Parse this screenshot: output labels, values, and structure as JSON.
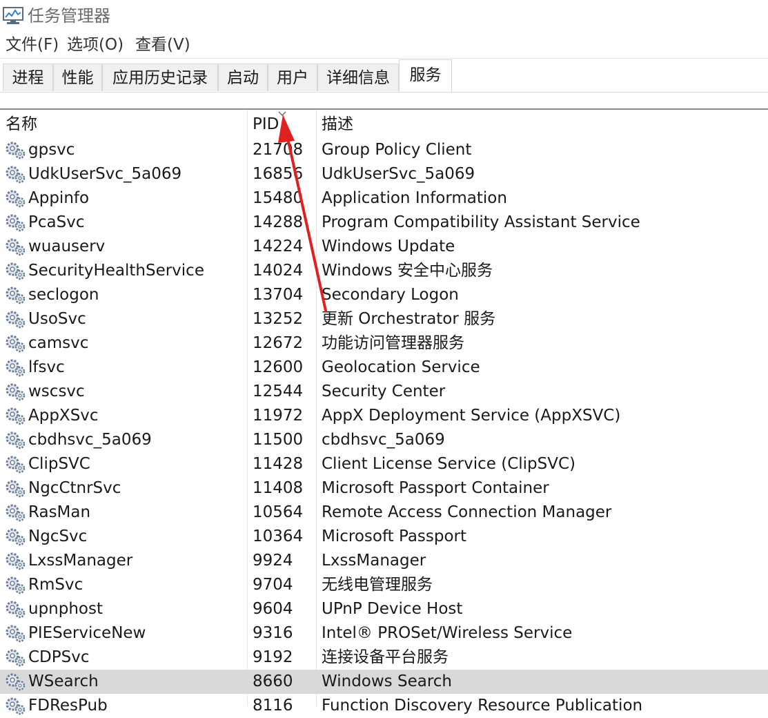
{
  "window": {
    "title": "任务管理器",
    "icon": "task-manager-icon"
  },
  "menu": [
    "文件(F)",
    "选项(O)",
    "查看(V)"
  ],
  "tabs": [
    {
      "label": "进程"
    },
    {
      "label": "性能"
    },
    {
      "label": "应用历史记录"
    },
    {
      "label": "启动"
    },
    {
      "label": "用户"
    },
    {
      "label": "详细信息"
    },
    {
      "label": "服务",
      "active": true
    }
  ],
  "columns": {
    "name": "名称",
    "pid": "PID",
    "desc": "描述",
    "sorted_by": "PID",
    "sort_direction": "descending"
  },
  "selected_row": "WSearch",
  "accent": {
    "selection": "#d9d9d9",
    "annotation_arrow": "#e02020"
  },
  "services": [
    {
      "name": "gpsvc",
      "pid": "21708",
      "desc": "Group Policy Client"
    },
    {
      "name": "UdkUserSvc_5a069",
      "pid": "16856",
      "desc": "UdkUserSvc_5a069"
    },
    {
      "name": "Appinfo",
      "pid": "15480",
      "desc": "Application Information"
    },
    {
      "name": "PcaSvc",
      "pid": "14288",
      "desc": "Program Compatibility Assistant Service"
    },
    {
      "name": "wuauserv",
      "pid": "14224",
      "desc": "Windows Update"
    },
    {
      "name": "SecurityHealthService",
      "pid": "14024",
      "desc": "Windows 安全中心服务"
    },
    {
      "name": "seclogon",
      "pid": "13704",
      "desc": "Secondary Logon"
    },
    {
      "name": "UsoSvc",
      "pid": "13252",
      "desc": "更新 Orchestrator 服务"
    },
    {
      "name": "camsvc",
      "pid": "12672",
      "desc": "功能访问管理器服务"
    },
    {
      "name": "lfsvc",
      "pid": "12600",
      "desc": "Geolocation Service"
    },
    {
      "name": "wscsvc",
      "pid": "12544",
      "desc": "Security Center"
    },
    {
      "name": "AppXSvc",
      "pid": "11972",
      "desc": "AppX Deployment Service (AppXSVC)"
    },
    {
      "name": "cbdhsvc_5a069",
      "pid": "11500",
      "desc": "cbdhsvc_5a069"
    },
    {
      "name": "ClipSVC",
      "pid": "11428",
      "desc": "Client License Service (ClipSVC)"
    },
    {
      "name": "NgcCtnrSvc",
      "pid": "11408",
      "desc": "Microsoft Passport Container"
    },
    {
      "name": "RasMan",
      "pid": "10564",
      "desc": "Remote Access Connection Manager"
    },
    {
      "name": "NgcSvc",
      "pid": "10364",
      "desc": "Microsoft Passport"
    },
    {
      "name": "LxssManager",
      "pid": "9924",
      "desc": "LxssManager"
    },
    {
      "name": "RmSvc",
      "pid": "9704",
      "desc": "无线电管理服务"
    },
    {
      "name": "upnphost",
      "pid": "9604",
      "desc": "UPnP Device Host"
    },
    {
      "name": "PIEServiceNew",
      "pid": "9316",
      "desc": "Intel® PROSet/Wireless Service"
    },
    {
      "name": "CDPSvc",
      "pid": "9192",
      "desc": "连接设备平台服务"
    },
    {
      "name": "WSearch",
      "pid": "8660",
      "desc": "Windows Search"
    },
    {
      "name": "FDResPub",
      "pid": "8116",
      "desc": "Function Discovery Resource Publication"
    }
  ]
}
